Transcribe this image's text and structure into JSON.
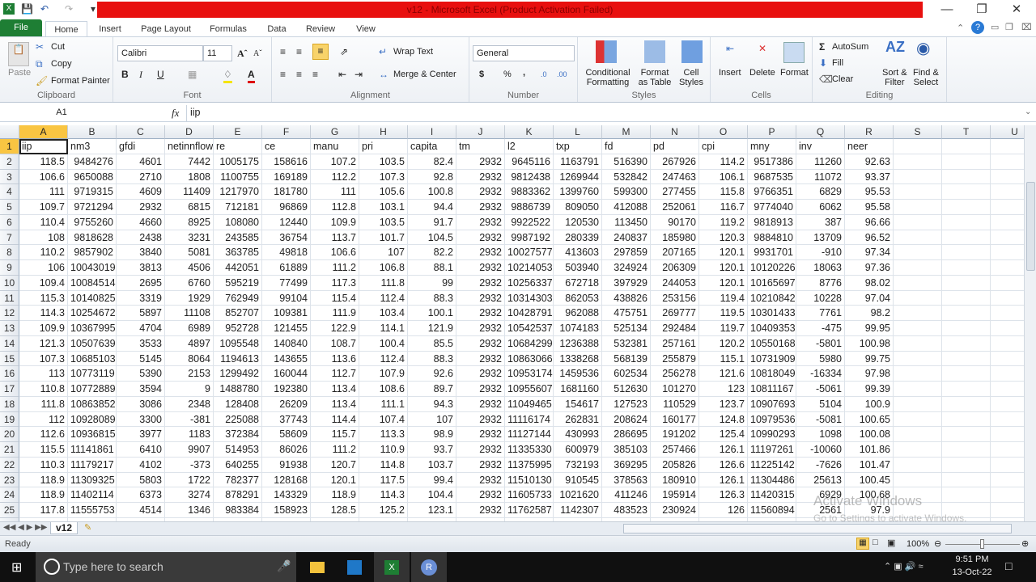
{
  "window": {
    "title": "v12  -  Microsoft Excel (Product Activation Failed)"
  },
  "ribbon_tabs": [
    "File",
    "Home",
    "Insert",
    "Page Layout",
    "Formulas",
    "Data",
    "Review",
    "View"
  ],
  "clipboard": {
    "paste": "Paste",
    "cut": "Cut",
    "copy": "Copy",
    "format_painter": "Format Painter",
    "label": "Clipboard"
  },
  "font": {
    "name": "Calibri",
    "size": "11",
    "label": "Font"
  },
  "alignment": {
    "wrap": "Wrap Text",
    "merge": "Merge & Center",
    "label": "Alignment"
  },
  "number": {
    "format": "General",
    "label": "Number",
    "currency": "$",
    "percent": "%",
    "comma": ","
  },
  "styles": {
    "conditional": "Conditional",
    "conditional2": "Formatting",
    "format_table": "Format",
    "format_table2": "as Table",
    "cell_styles": "Cell",
    "cell_styles2": "Styles",
    "label": "Styles"
  },
  "cells": {
    "insert": "Insert",
    "delete": "Delete",
    "format": "Format",
    "label": "Cells"
  },
  "editing": {
    "autosum": "AutoSum",
    "fill": "Fill",
    "clear": "Clear",
    "sort": "Sort &",
    "sort2": "Filter",
    "find": "Find &",
    "find2": "Select",
    "label": "Editing"
  },
  "formula_bar": {
    "name_box": "A1",
    "fx": "fx",
    "value": "iip"
  },
  "grid": {
    "columns": [
      "A",
      "B",
      "C",
      "D",
      "E",
      "F",
      "G",
      "H",
      "I",
      "J",
      "K",
      "L",
      "M",
      "N",
      "O",
      "P",
      "Q",
      "R",
      "S",
      "T",
      "U"
    ],
    "selected_cell": "A1",
    "header": [
      "iip",
      "nm3",
      "gfdi",
      "netinnflow",
      "re",
      "ce",
      "manu",
      "pri",
      "capita",
      "tm",
      "l2",
      "txp",
      "fd",
      "pd",
      "cpi",
      "mny",
      "inv",
      "neer"
    ],
    "rows": [
      [
        "118.5",
        "9484276",
        "4601",
        "7442",
        "1005175",
        "158616",
        "107.2",
        "103.5",
        "82.4",
        "2932",
        "9645116",
        "1163791",
        "516390",
        "267926",
        "114.2",
        "9517386",
        "11260",
        "92.63"
      ],
      [
        "106.6",
        "9650088",
        "2710",
        "1808",
        "1100755",
        "169189",
        "112.2",
        "107.3",
        "92.8",
        "2932",
        "9812438",
        "1269944",
        "532842",
        "247463",
        "106.1",
        "9687535",
        "11072",
        "93.37"
      ],
      [
        "111",
        "9719315",
        "4609",
        "11409",
        "1217970",
        "181780",
        "111",
        "105.6",
        "100.8",
        "2932",
        "9883362",
        "1399760",
        "599300",
        "277455",
        "115.8",
        "9766351",
        "6829",
        "95.53"
      ],
      [
        "109.7",
        "9721294",
        "2932",
        "6815",
        "712181",
        "96869",
        "112.8",
        "103.1",
        "94.4",
        "2932",
        "9886739",
        "809050",
        "412088",
        "252061",
        "116.7",
        "9774040",
        "6062",
        "95.58"
      ],
      [
        "110.4",
        "9755260",
        "4660",
        "8925",
        "108080",
        "12440",
        "109.9",
        "103.5",
        "91.7",
        "2932",
        "9922522",
        "120530",
        "113450",
        "90170",
        "119.2",
        "9818913",
        "387",
        "96.66"
      ],
      [
        "108",
        "9818628",
        "2438",
        "3231",
        "243585",
        "36754",
        "113.7",
        "101.7",
        "104.5",
        "2932",
        "9987192",
        "280339",
        "240837",
        "185980",
        "120.3",
        "9884810",
        "13709",
        "96.52"
      ],
      [
        "110.2",
        "9857902",
        "3840",
        "5081",
        "363785",
        "49818",
        "106.6",
        "107",
        "82.2",
        "2932",
        "10027577",
        "413603",
        "297859",
        "207165",
        "120.1",
        "9931701",
        "-910",
        "97.34"
      ],
      [
        "106",
        "10043019",
        "3813",
        "4506",
        "442051",
        "61889",
        "111.2",
        "106.8",
        "88.1",
        "2932",
        "10214053",
        "503940",
        "324924",
        "206309",
        "120.1",
        "10120226",
        "18063",
        "97.36"
      ],
      [
        "109.4",
        "10084514",
        "2695",
        "6760",
        "595219",
        "77499",
        "117.3",
        "111.8",
        "99",
        "2932",
        "10256337",
        "672718",
        "397929",
        "244053",
        "120.1",
        "10165697",
        "8776",
        "98.02"
      ],
      [
        "115.3",
        "10140825",
        "3319",
        "1929",
        "762949",
        "99104",
        "115.4",
        "112.4",
        "88.3",
        "2932",
        "10314303",
        "862053",
        "438826",
        "253156",
        "119.4",
        "10210842",
        "10228",
        "97.04"
      ],
      [
        "114.3",
        "10254672",
        "5897",
        "11108",
        "852707",
        "109381",
        "111.9",
        "103.4",
        "100.1",
        "2932",
        "10428791",
        "962088",
        "475751",
        "269777",
        "119.5",
        "10301433",
        "7761",
        "98.2"
      ],
      [
        "109.9",
        "10367995",
        "4704",
        "6989",
        "952728",
        "121455",
        "122.9",
        "114.1",
        "121.9",
        "2932",
        "10542537",
        "1074183",
        "525134",
        "292484",
        "119.7",
        "10409353",
        "-475",
        "99.95"
      ],
      [
        "121.3",
        "10507639",
        "3533",
        "4897",
        "1095548",
        "140840",
        "108.7",
        "100.4",
        "85.5",
        "2932",
        "10684299",
        "1236388",
        "532381",
        "257161",
        "120.2",
        "10550168",
        "-5801",
        "100.98"
      ],
      [
        "107.3",
        "10685103",
        "5145",
        "8064",
        "1194613",
        "143655",
        "113.6",
        "112.4",
        "88.3",
        "2932",
        "10863066",
        "1338268",
        "568139",
        "255879",
        "115.1",
        "10731909",
        "5980",
        "99.75"
      ],
      [
        "113",
        "10773119",
        "5390",
        "2153",
        "1299492",
        "160044",
        "112.7",
        "107.9",
        "92.6",
        "2932",
        "10953174",
        "1459536",
        "602534",
        "256278",
        "121.6",
        "10818049",
        "-16334",
        "97.98"
      ],
      [
        "110.8",
        "10772889",
        "3594",
        "9",
        "1488780",
        "192380",
        "113.4",
        "108.6",
        "89.7",
        "2932",
        "10955607",
        "1681160",
        "512630",
        "101270",
        "123",
        "10811167",
        "-5061",
        "99.39"
      ],
      [
        "111.8",
        "10863852",
        "3086",
        "2348",
        "128408",
        "26209",
        "113.4",
        "111.1",
        "94.3",
        "2932",
        "11049465",
        "154617",
        "127523",
        "110529",
        "123.7",
        "10907693",
        "5104",
        "100.9"
      ],
      [
        "112",
        "10928089",
        "3300",
        "-381",
        "225088",
        "37743",
        "114.4",
        "107.4",
        "107",
        "2932",
        "11116174",
        "262831",
        "208624",
        "160177",
        "124.8",
        "10979536",
        "-5081",
        "100.65"
      ],
      [
        "112.6",
        "10936815",
        "3977",
        "1183",
        "372384",
        "58609",
        "115.7",
        "113.3",
        "98.9",
        "2932",
        "11127144",
        "430993",
        "286695",
        "191202",
        "125.4",
        "10990293",
        "1098",
        "100.08"
      ],
      [
        "115.5",
        "11141861",
        "6410",
        "9907",
        "514953",
        "86026",
        "111.2",
        "110.9",
        "93.7",
        "2932",
        "11335330",
        "600979",
        "385103",
        "257466",
        "126.1",
        "11197261",
        "-10060",
        "101.86"
      ],
      [
        "110.3",
        "11179217",
        "4102",
        "-373",
        "640255",
        "91938",
        "120.7",
        "114.8",
        "103.7",
        "2932",
        "11375995",
        "732193",
        "369295",
        "205826",
        "126.6",
        "11225142",
        "-7626",
        "101.47"
      ],
      [
        "118.9",
        "11309325",
        "5803",
        "1722",
        "782377",
        "128168",
        "120.1",
        "117.5",
        "99.4",
        "2932",
        "11510130",
        "910545",
        "378563",
        "180910",
        "126.1",
        "11304486",
        "25613",
        "100.45"
      ],
      [
        "118.9",
        "11402114",
        "6373",
        "3274",
        "878291",
        "143329",
        "118.9",
        "114.3",
        "104.4",
        "2932",
        "11605733",
        "1021620",
        "411246",
        "195914",
        "126.3",
        "11420315",
        "6929",
        "100.68"
      ],
      [
        "117.8",
        "11555753",
        "4514",
        "1346",
        "983384",
        "158923",
        "128.5",
        "125.2",
        "123.1",
        "2932",
        "11762587",
        "1142307",
        "483523",
        "230924",
        "126",
        "11560894",
        "2561",
        "97.9"
      ]
    ]
  },
  "sheet_tabs": [
    "v12"
  ],
  "status": {
    "text": "Ready",
    "zoom": "100%",
    "zoom_level": 100
  },
  "watermark": {
    "line1": "Activate Windows",
    "line2": "Go to Settings to activate Windows."
  },
  "taskbar": {
    "search_placeholder": "Type here to search",
    "time": "9:51 PM",
    "date": "13-Oct-22"
  }
}
